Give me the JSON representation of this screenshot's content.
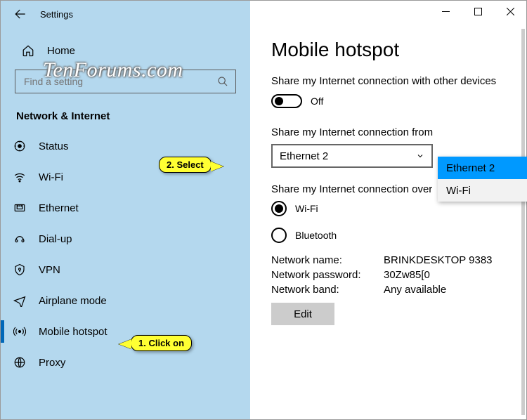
{
  "window": {
    "title": "Settings"
  },
  "watermark": "TenForums.com",
  "sidebar": {
    "home": "Home",
    "search_placeholder": "Find a setting",
    "section": "Network & Internet",
    "items": [
      {
        "label": "Status"
      },
      {
        "label": "Wi-Fi"
      },
      {
        "label": "Ethernet"
      },
      {
        "label": "Dial-up"
      },
      {
        "label": "VPN"
      },
      {
        "label": "Airplane mode"
      },
      {
        "label": "Mobile hotspot"
      },
      {
        "label": "Proxy"
      }
    ]
  },
  "main": {
    "title": "Mobile hotspot",
    "share_label": "Share my Internet connection with other devices",
    "toggle_state": "Off",
    "from_label": "Share my Internet connection from",
    "from_value": "Ethernet 2",
    "from_options": [
      "Ethernet 2",
      "Wi-Fi"
    ],
    "over_label": "Share my Internet connection over",
    "over_options": [
      {
        "label": "Wi-Fi",
        "checked": true
      },
      {
        "label": "Bluetooth",
        "checked": false
      }
    ],
    "info": {
      "name_label": "Network name:",
      "name_value": "BRINKDESKTOP 9383",
      "pw_label": "Network password:",
      "pw_value": "30Zw85[0",
      "band_label": "Network band:",
      "band_value": "Any available"
    },
    "edit": "Edit"
  },
  "callouts": {
    "c1": "1. Click on",
    "c2": "2. Select"
  }
}
